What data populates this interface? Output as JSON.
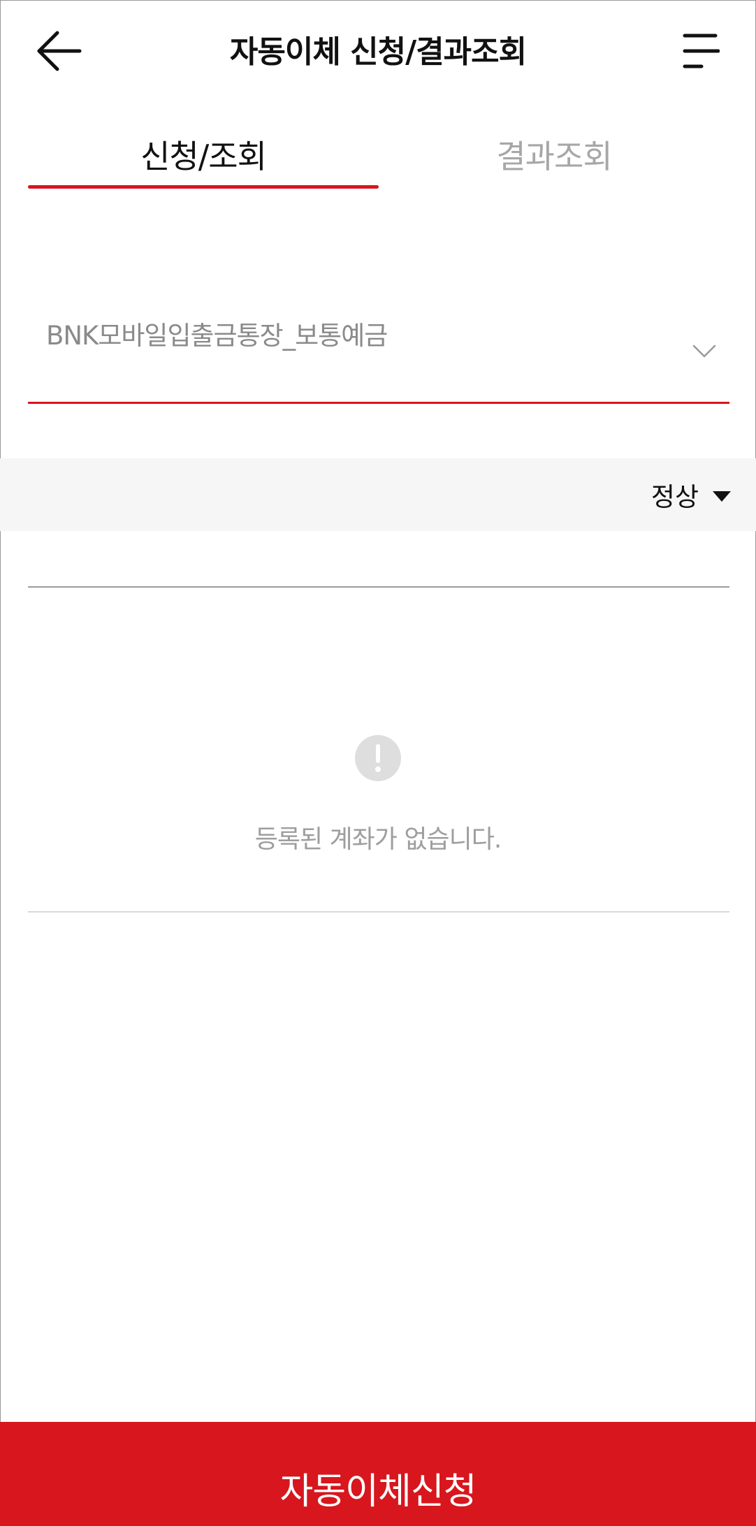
{
  "header": {
    "title": "자동이체 신청/결과조회",
    "back_icon": "arrow-left-icon",
    "menu_icon": "menu-icon"
  },
  "tabs": [
    {
      "label": "신청/조회",
      "active": true
    },
    {
      "label": "결과조회",
      "active": false
    }
  ],
  "account_select": {
    "value": "BNK모바일입출금통장_보통예금",
    "icon": "chevron-down-icon"
  },
  "filter": {
    "status_label": "정상",
    "icon": "caret-down-icon"
  },
  "empty_state": {
    "icon": "alert-circle-icon",
    "message": "등록된 계좌가 없습니다."
  },
  "bottom_button": {
    "label": "자동이체신청"
  },
  "colors": {
    "accent": "#d7161e",
    "muted_text": "#a7a7a7",
    "filter_bg": "#f6f6f6"
  }
}
